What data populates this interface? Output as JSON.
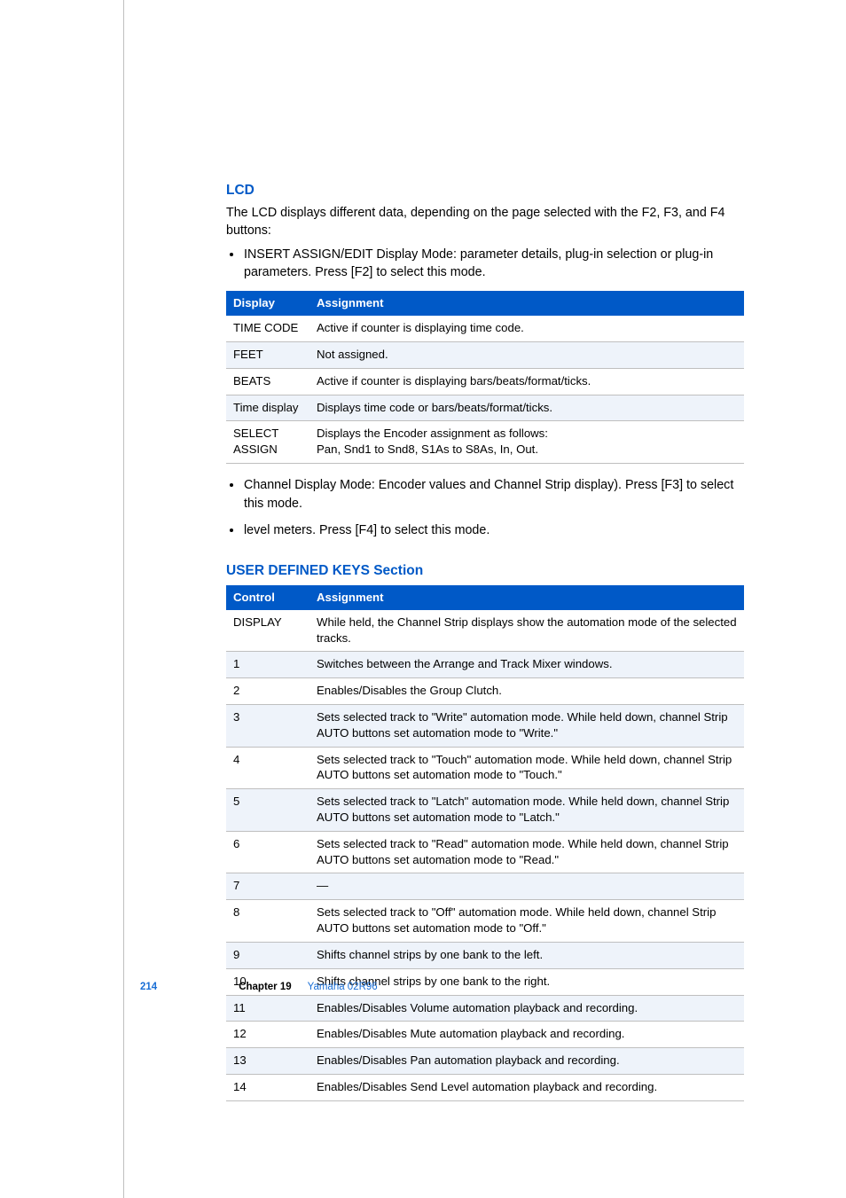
{
  "section_lcd": {
    "heading": "LCD",
    "intro": "The LCD displays different data, depending on the page selected with the F2, F3, and F4 buttons:",
    "bullet_top": "INSERT ASSIGN/EDIT Display Mode:  parameter details, plug-in selection or plug-in parameters. Press [F2] to select this mode.",
    "table_headers": {
      "col1": "Display",
      "col2": "Assignment"
    },
    "rows": [
      {
        "c1": "TIME CODE",
        "c2": "Active if counter is displaying time code."
      },
      {
        "c1": "FEET",
        "c2": "Not assigned."
      },
      {
        "c1": "BEATS",
        "c2": "Active if counter is displaying bars/beats/format/ticks."
      },
      {
        "c1": "Time display",
        "c2": "Displays time code or bars/beats/format/ticks."
      },
      {
        "c1": "SELECT ASSIGN",
        "c2": "Displays the Encoder assignment as follows:\nPan, Snd1 to Snd8, S1As to S8As, In, Out."
      }
    ],
    "bullets_after": [
      "Channel Display Mode:  Encoder values and Channel Strip display). Press [F3] to select this mode.",
      "level meters. Press [F4] to select this mode."
    ]
  },
  "section_udk": {
    "heading": "USER DEFINED KEYS Section",
    "table_headers": {
      "col1": "Control",
      "col2": "Assignment"
    },
    "rows": [
      {
        "c1": "DISPLAY",
        "c2": "While held, the Channel Strip displays show the automation mode of the selected tracks."
      },
      {
        "c1": "1",
        "c2": "Switches between the Arrange and Track Mixer windows."
      },
      {
        "c1": "2",
        "c2": "Enables/Disables the Group Clutch."
      },
      {
        "c1": "3",
        "c2": "Sets selected track to \"Write\" automation mode. While held down, channel Strip AUTO buttons set automation mode to \"Write.\""
      },
      {
        "c1": "4",
        "c2": "Sets selected track to \"Touch\" automation mode. While held down, channel Strip AUTO buttons set automation mode to \"Touch.\""
      },
      {
        "c1": "5",
        "c2": "Sets selected track to \"Latch\" automation mode. While held down, channel Strip AUTO buttons set automation mode to \"Latch.\""
      },
      {
        "c1": "6",
        "c2": "Sets selected track to \"Read\" automation mode. While held down, channel Strip AUTO buttons set automation mode to \"Read.\""
      },
      {
        "c1": "7",
        "c2": "—"
      },
      {
        "c1": "8",
        "c2": "Sets selected track to \"Off\" automation mode. While held down, channel Strip AUTO buttons set automation mode to \"Off.\""
      },
      {
        "c1": "9",
        "c2": "Shifts channel strips by one bank to the left."
      },
      {
        "c1": "10",
        "c2": "Shifts channel strips by one bank to the right."
      },
      {
        "c1": "11",
        "c2": "Enables/Disables Volume automation playback and recording."
      },
      {
        "c1": "12",
        "c2": "Enables/Disables Mute automation playback and recording."
      },
      {
        "c1": "13",
        "c2": "Enables/Disables Pan automation playback and recording."
      },
      {
        "c1": "14",
        "c2": "Enables/Disables Send Level automation playback and recording."
      }
    ]
  },
  "footer": {
    "page_number": "214",
    "chapter_label": "Chapter 19",
    "chapter_title": "Yamaha 02R96"
  }
}
